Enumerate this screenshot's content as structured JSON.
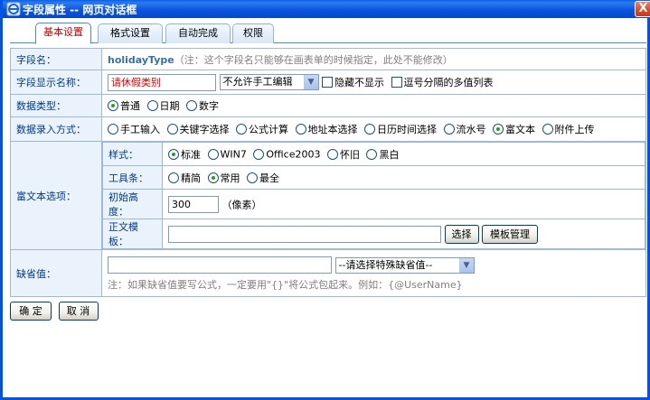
{
  "window": {
    "title": "字段属性 -- 网页对话框",
    "close_glyph": "X"
  },
  "tabs": [
    {
      "label": "基本设置",
      "active": true
    },
    {
      "label": "格式设置",
      "active": false
    },
    {
      "label": "自动完成",
      "active": false
    },
    {
      "label": "权限",
      "active": false
    }
  ],
  "form": {
    "field_name": {
      "label": "字段名：",
      "value": "holidayType",
      "note": "（注：这个字段名只能够在画表单的时候指定，此处不能修改）"
    },
    "display_name": {
      "label": "字段显示名称：",
      "value": "请休假类别",
      "edit_mode": "不允许手工编辑",
      "hide_label": "隐藏不显示",
      "multi_value_label": "逗号分隔的多值列表"
    },
    "data_type": {
      "label": "数据类型：",
      "options": [
        "普通",
        "日期",
        "数字"
      ],
      "selected": "普通"
    },
    "input_mode": {
      "label": "数据录入方式：",
      "options": [
        "手工输入",
        "关键字选择",
        "公式计算",
        "地址本选择",
        "日历时间选择",
        "流水号",
        "富文本",
        "附件上传"
      ],
      "selected": "富文本"
    },
    "rich_text": {
      "label": "富文本选项：",
      "style": {
        "label": "样式：",
        "options": [
          "标准",
          "WIN7",
          "Office2003",
          "怀旧",
          "黑白"
        ],
        "selected": "标准"
      },
      "toolbar": {
        "label": "工具条：",
        "options": [
          "精简",
          "常用",
          "最全"
        ],
        "selected": "常用"
      },
      "height": {
        "label": "初始高度：",
        "value": "300",
        "unit": "（像素）"
      },
      "template": {
        "label": "正文模板：",
        "value": "",
        "select_button": "选择",
        "manage_button": "模板管理"
      }
    },
    "default_value": {
      "label": "缺省值：",
      "value": "",
      "special_select": "--请选择特殊缺省值--",
      "note": "注：如果缺省值要写公式，一定要用\"{}\"将公式包起来。例如：{@UserName}"
    }
  },
  "buttons": {
    "ok": "确 定",
    "cancel": "取 消"
  }
}
